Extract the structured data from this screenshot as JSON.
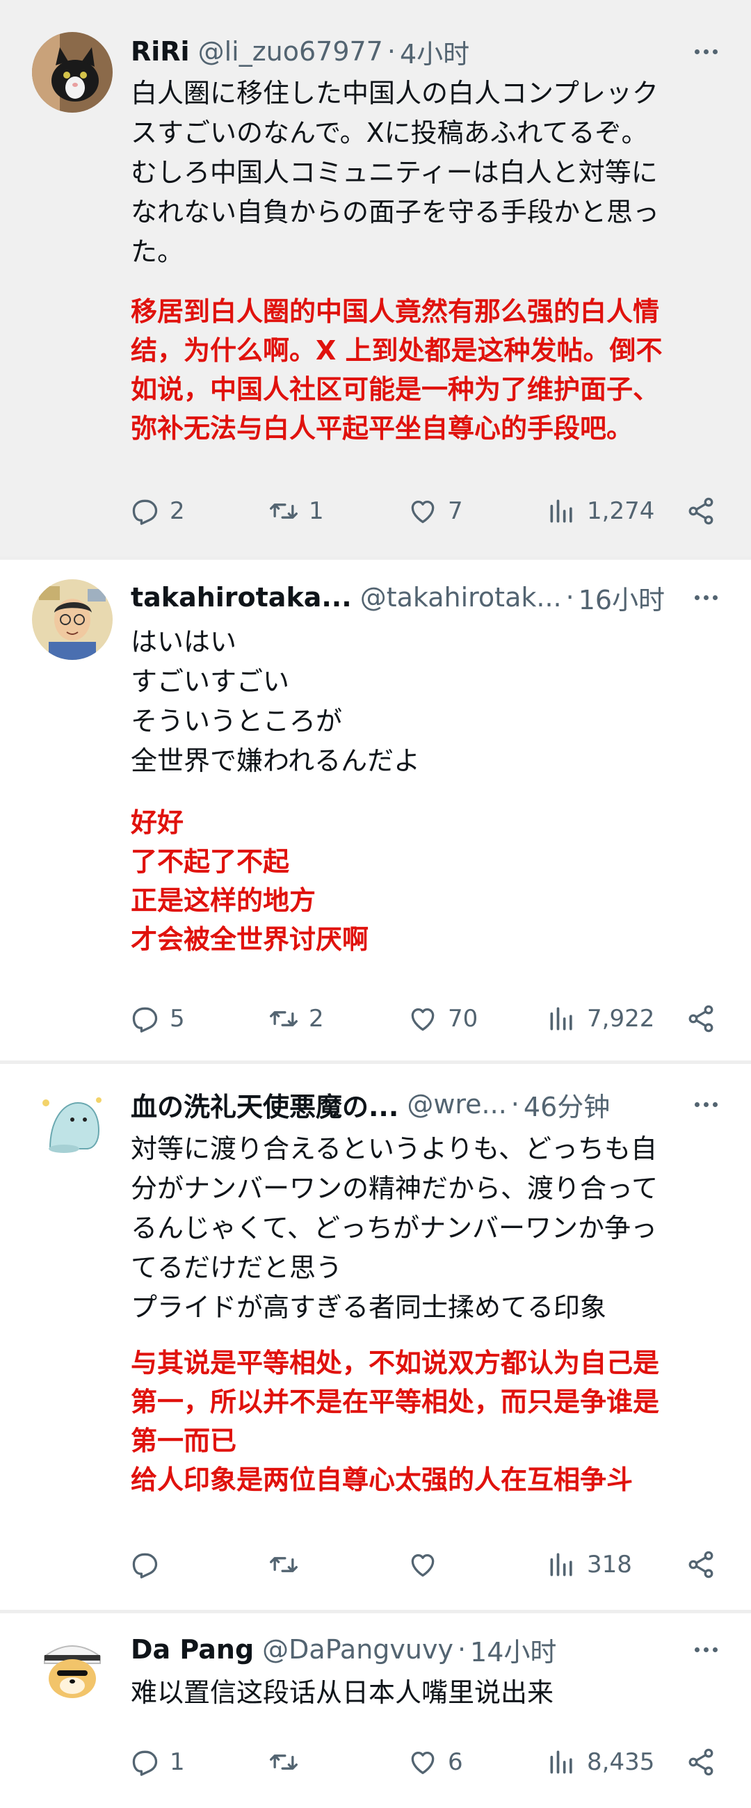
{
  "tweets": [
    {
      "name": "RiRi",
      "handle": "@li_zuo67977",
      "time": "4小时",
      "text_ja": [
        "白人圏に移住した中国人の白人コンプレック",
        "スすごいのなんで。Xに投稿あふれてるぞ。",
        "むしろ中国人コミュニティーは白人と対等に",
        "なれない自負からの面子を守る手段かと思っ",
        "た。"
      ],
      "text_zh": [
        "移居到白人圈的中国人竟然有那么强的白人情",
        "结，为什么啊。X 上到处都是这种发帖。倒不",
        "如说，中国人社区可能是一种为了维护面子、",
        "弥补无法与白人平起平坐自尊心的手段吧。"
      ],
      "replies": "2",
      "retweets": "1",
      "likes": "7",
      "views": "1,274"
    },
    {
      "name": "takahirotaka...",
      "handle": "@takahirotak...",
      "time": "16小时",
      "text_ja": [
        "はいはい",
        "すごいすごい",
        "そういうところが",
        "全世界で嫌われるんだよ"
      ],
      "text_zh": [
        "好好",
        "了不起了不起",
        "正是这样的地方",
        "才会被全世界讨厌啊"
      ],
      "replies": "5",
      "retweets": "2",
      "likes": "70",
      "views": "7,922"
    },
    {
      "name": "血の洗礼天使悪魔の...",
      "handle": "@wre...",
      "time": "46分钟",
      "text_ja": [
        "対等に渡り合えるというよりも、どっちも自",
        "分がナンバーワンの精神だから、渡り合って",
        "るんじゃくて、どっちがナンバーワンか争っ",
        "てるだけだと思う",
        "プライドが高すぎる者同士揉めてる印象"
      ],
      "text_zh": [
        "与其说是平等相处，不如说双方都认为自己是",
        "第一，所以并不是在平等相处，而只是争谁是",
        "第一而已",
        "给人印象是两位自尊心太强的人在互相争斗"
      ],
      "replies": "",
      "retweets": "",
      "likes": "",
      "views": "318"
    },
    {
      "name": "Da Pang",
      "handle": "@DaPangvuvy",
      "time": "14小时",
      "text_ja": [
        "难以置信这段话从日本人嘴里说出来"
      ],
      "text_zh": [],
      "replies": "1",
      "retweets": "",
      "likes": "6",
      "views": "8,435"
    }
  ],
  "separator_dot": "·",
  "icons": [
    "reply-icon",
    "retweet-icon",
    "like-icon",
    "views-icon",
    "share-icon",
    "more-icon"
  ],
  "colors": {
    "translation": "#e0120d",
    "meta": "#536471",
    "highlight_bg": "#f0f0f0"
  }
}
